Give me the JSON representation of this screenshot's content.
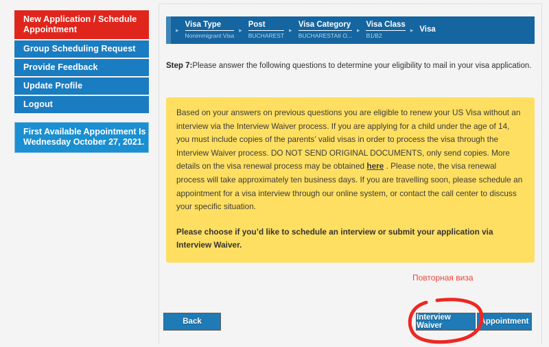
{
  "sidebar": {
    "items": [
      {
        "label": "New Application / Schedule Appointment",
        "active": true
      },
      {
        "label": "Group Scheduling Request",
        "active": false
      },
      {
        "label": "Provide Feedback",
        "active": false
      },
      {
        "label": "Update Profile",
        "active": false
      },
      {
        "label": "Logout",
        "active": false
      }
    ],
    "appointment_notice": "First Available Appointment Is Wednesday October 27, 2021."
  },
  "breadcrumb": {
    "steps": [
      {
        "label": "Visa Type",
        "value": "Nonimmigrant Visa"
      },
      {
        "label": "Post",
        "value": "BUCHAREST"
      },
      {
        "label": "Visa Category",
        "value": "BUCHARESTAII O..."
      },
      {
        "label": "Visa Class",
        "value": "B1/B2"
      },
      {
        "label": "Visa",
        "value": ""
      }
    ],
    "arrow_icon": "chevron-right-icon"
  },
  "step": {
    "number": "Step 7:",
    "instruction": "Please answer the following questions to determine your eligibility to mail in your visa application."
  },
  "notice": {
    "paragraph_1_part_1": "Based on your answers on previous questions you are eligible to renew your US Visa without an interview via the Interview Waiver process. If you are applying for a child under the age of 14, you must include copies of the parents’ valid visas in order to process the visa through the Interview Waiver process. DO NOT SEND ORIGINAL DOCUMENTS, only send copies. More details on the visa renewal process may be obtained ",
    "link_text": "here",
    "paragraph_1_part_2": " . Please note,  the visa renewal process will take approximately ten business days. If you are travelling soon, please schedule an appointment for a visa interview through our online system, or contact the call center to discuss your specific situation.",
    "paragraph_2": "Please choose if you’d like to schedule an interview or submit your application via Interview Waiver."
  },
  "annotation": {
    "red_text": "Повторная виза",
    "highlight_color": "#ee2722",
    "highlight_target": "Interview Waiver"
  },
  "buttons": {
    "back": "Back",
    "interview_waiver": "Interview Waiver",
    "appointment": "Appointment"
  },
  "colors": {
    "sidebar_blue": "#1a7cc1",
    "sidebar_red": "#e0261c",
    "breadcrumb_blue": "#1565a0",
    "notice_yellow": "#ffdf61",
    "button_blue": "#1f7ab5"
  }
}
